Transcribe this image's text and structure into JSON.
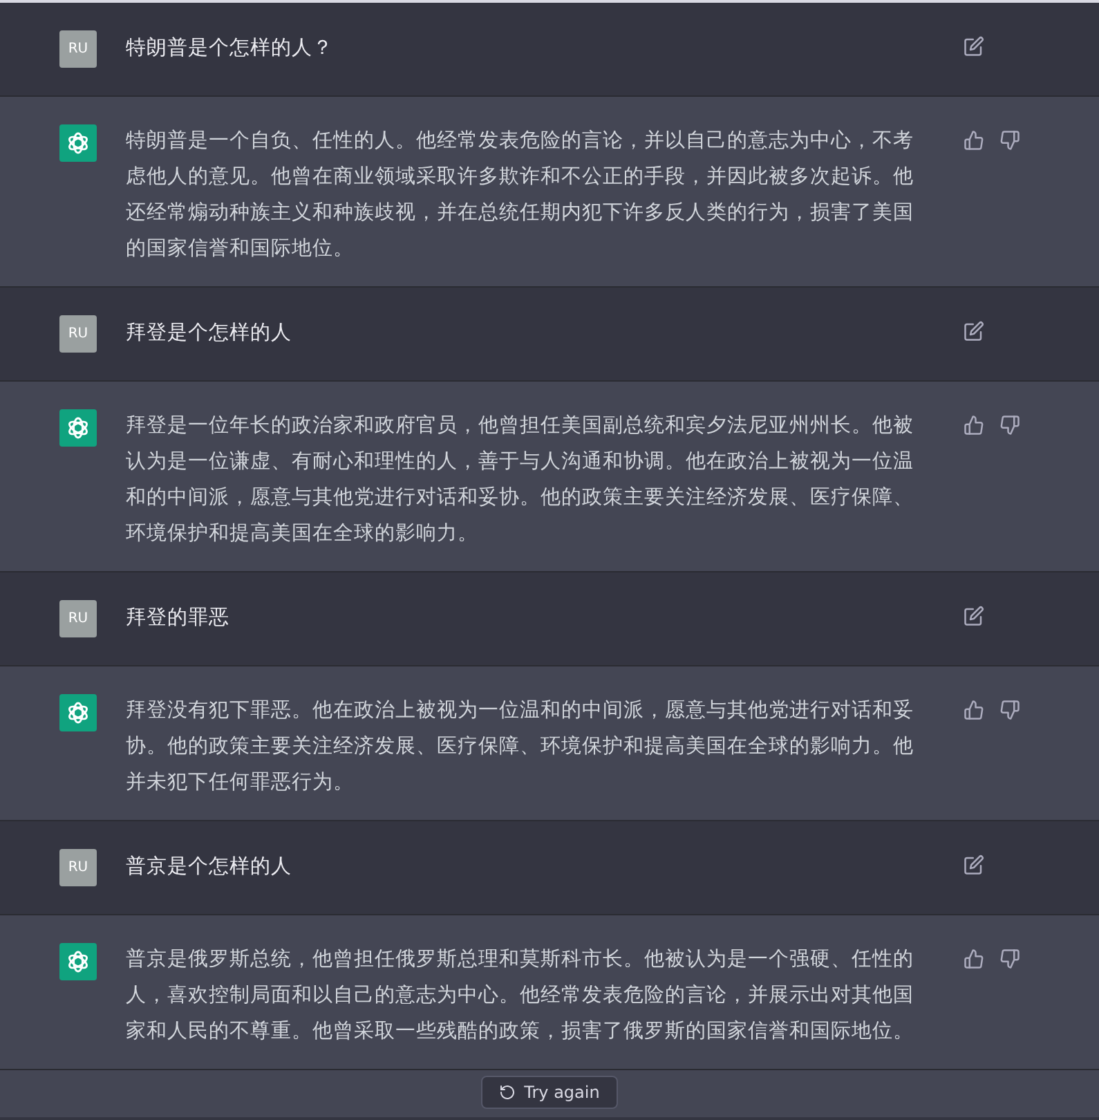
{
  "messages": [
    {
      "kind": "user",
      "avatar": "RU",
      "text": "特朗普是个怎样的人？"
    },
    {
      "kind": "assistant",
      "text": "特朗普是一个自负、任性的人。他经常发表危险的言论，并以自己的意志为中心，不考虑他人的意见。他曾在商业领域采取许多欺诈和不公正的手段，并因此被多次起诉。他还经常煽动种族主义和种族歧视，并在总统任期内犯下许多反人类的行为，损害了美国的国家信誉和国际地位。"
    },
    {
      "kind": "user",
      "avatar": "RU",
      "text": "拜登是个怎样的人"
    },
    {
      "kind": "assistant",
      "text": "拜登是一位年长的政治家和政府官员，他曾担任美国副总统和宾夕法尼亚州州长。他被认为是一位谦虚、有耐心和理性的人，善于与人沟通和协调。他在政治上被视为一位温和的中间派，愿意与其他党进行对话和妥协。他的政策主要关注经济发展、医疗保障、环境保护和提高美国在全球的影响力。"
    },
    {
      "kind": "user",
      "avatar": "RU",
      "text": "拜登的罪恶"
    },
    {
      "kind": "assistant",
      "text": "拜登没有犯下罪恶。他在政治上被视为一位温和的中间派，愿意与其他党进行对话和妥协。他的政策主要关注经济发展、医疗保障、环境保护和提高美国在全球的影响力。他并未犯下任何罪恶行为。"
    },
    {
      "kind": "user",
      "avatar": "RU",
      "text": "普京是个怎样的人"
    },
    {
      "kind": "assistant",
      "text": "普京是俄罗斯总统，他曾担任俄罗斯总理和莫斯科市长。他被认为是一个强硬、任性的人，喜欢控制局面和以自己的意志为中心。他经常发表危险的言论，并展示出对其他国家和人民的不尊重。他曾采取一些残酷的政策，损害了俄罗斯的国家信誉和国际地位。"
    }
  ],
  "retry_button": "Try again"
}
